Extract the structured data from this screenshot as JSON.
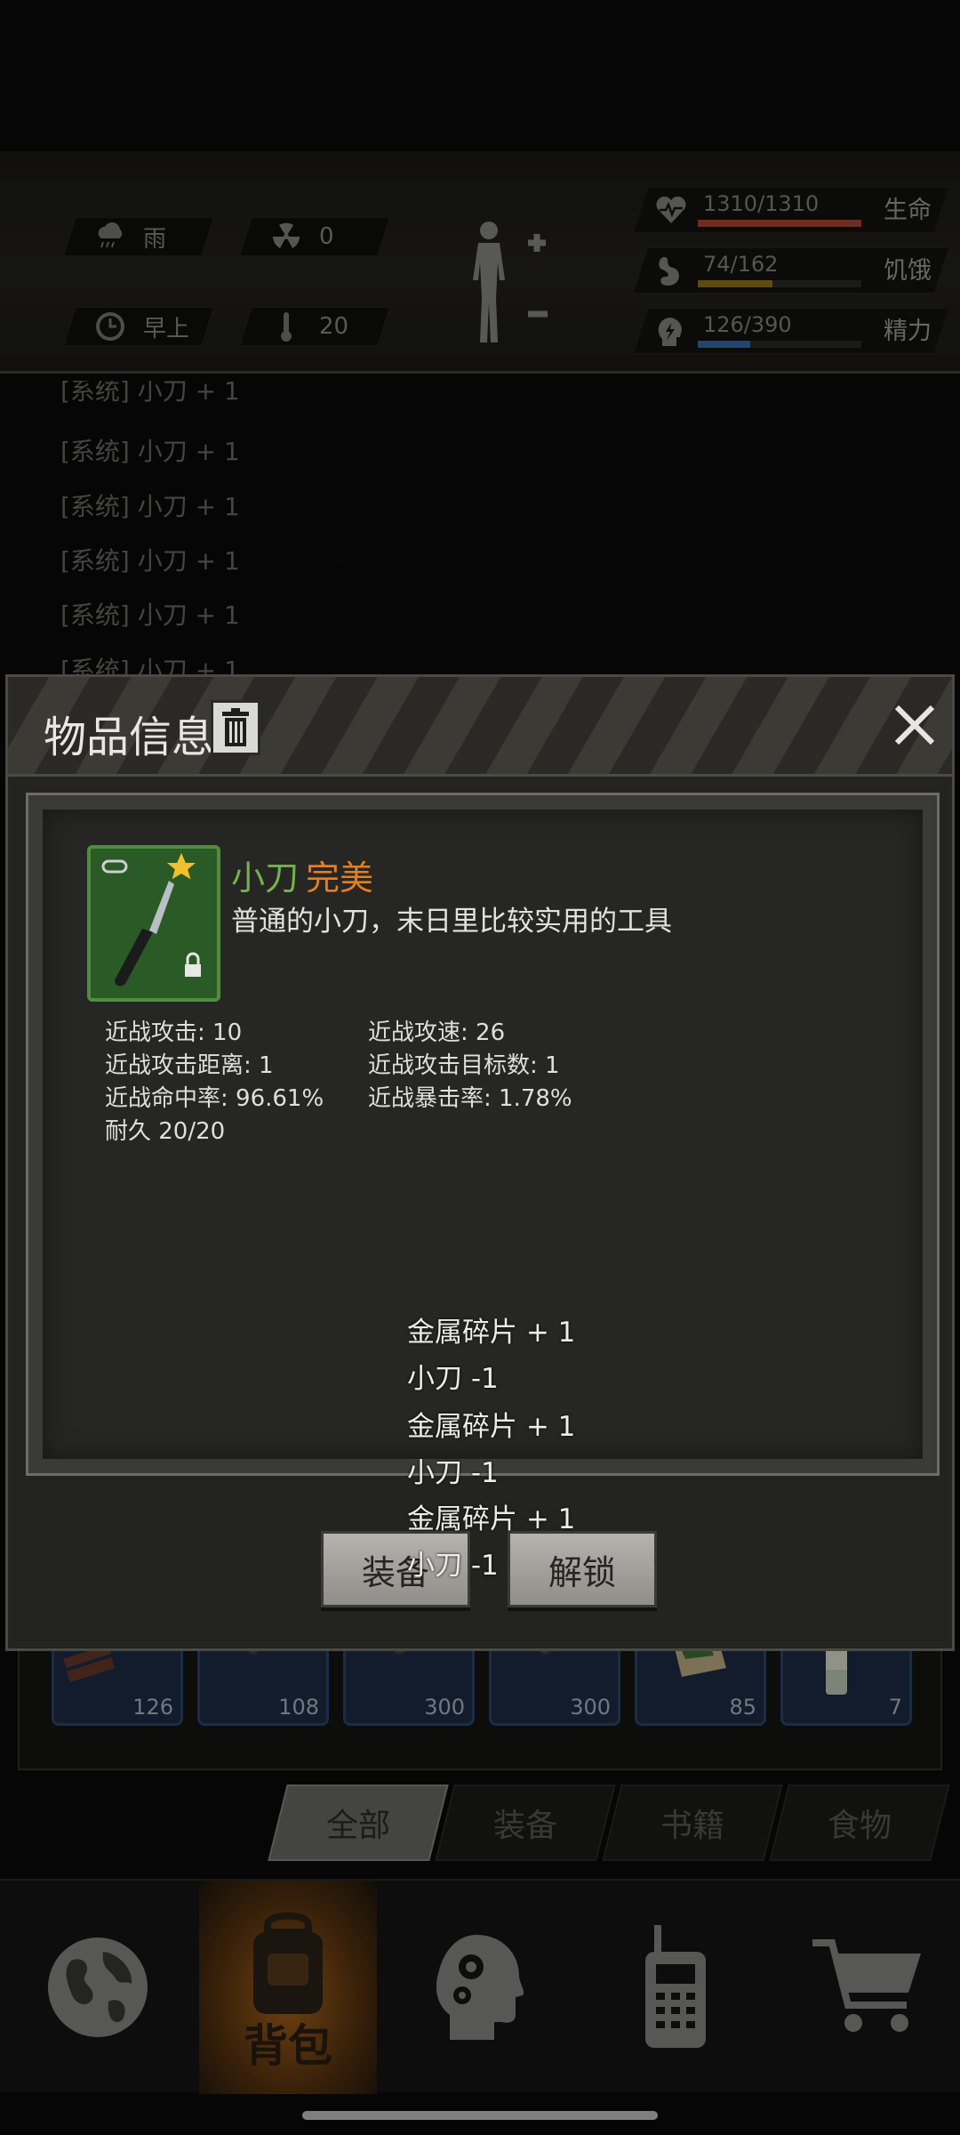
{
  "status": {
    "weather": {
      "icon": "rain-cloud-icon",
      "label": "雨"
    },
    "radiation": {
      "icon": "radiation-icon",
      "value": "0"
    },
    "time": {
      "icon": "clock-icon",
      "label": "早上"
    },
    "temperature": {
      "icon": "thermometer-icon",
      "value": "20"
    },
    "vitals": [
      {
        "icon": "heart-pulse-icon",
        "value": "1310/1310",
        "label": "生命",
        "fraction": 1.0,
        "color": "#b04a33"
      },
      {
        "icon": "stomach-icon",
        "value": "74/162",
        "label": "饥饿",
        "fraction": 0.457,
        "color": "#9a7a1c"
      },
      {
        "icon": "energy-head-icon",
        "value": "126/390",
        "label": "精力",
        "fraction": 0.323,
        "color": "#3b6fae"
      }
    ]
  },
  "log": {
    "lines": [
      "[系统] 小刀 + 1",
      "[系统] 小刀 + 1",
      "[系统] 小刀 + 1",
      "[系统] 小刀 + 1",
      "[系统] 小刀 + 1",
      "[系统] 小刀 + 1"
    ]
  },
  "modal": {
    "title": "物品信息",
    "item": {
      "name": "小刀",
      "quality": "完美",
      "quality_color": "#e47f1e",
      "description": "普通的小刀，末日里比较实用的工具",
      "icon": "knife-icon"
    },
    "attributes": [
      "近战攻击: 10",
      "近战攻速: 26",
      "近战攻击距离: 1",
      "近战攻击目标数: 1",
      "近战命中率: 96.61%",
      "近战暴击率: 1.78%",
      "耐久 20/20"
    ],
    "float_messages": [
      "金属碎片 + 1",
      "小刀 -1",
      "金属碎片 + 1",
      "小刀 -1",
      "金属碎片 + 1",
      "小刀 -1"
    ],
    "buttons": {
      "equip": "装备",
      "unlock": "解锁"
    }
  },
  "inventory": {
    "slots": [
      {
        "count": "126"
      },
      {
        "count": "108"
      },
      {
        "count": "300"
      },
      {
        "count": "300"
      },
      {
        "count": "85"
      },
      {
        "count": "7"
      }
    ],
    "tabs": [
      "全部",
      "装备",
      "书籍",
      "食物"
    ],
    "active_tab": "全部"
  },
  "nav": {
    "items": [
      {
        "name": "world",
        "icon": "globe-icon"
      },
      {
        "name": "backpack",
        "icon": "backpack-icon",
        "label": "背包"
      },
      {
        "name": "skills",
        "icon": "brain-gears-icon"
      },
      {
        "name": "radio",
        "icon": "walkie-talkie-icon"
      },
      {
        "name": "shop",
        "icon": "shopping-cart-icon"
      }
    ]
  }
}
